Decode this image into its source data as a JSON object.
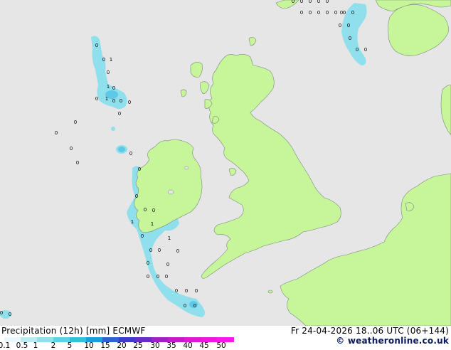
{
  "footer": {
    "title": "Precipitation (12h) [mm] ECMWF",
    "datetime": "Fr 24-04-2026 18..06 UTC (06+144)",
    "credit": "© weatheronline.co.uk"
  },
  "legend": {
    "ticks": [
      "0.1",
      "0.5",
      "1",
      "2",
      "5",
      "10",
      "15",
      "20",
      "25",
      "30",
      "35",
      "40",
      "45",
      "50"
    ],
    "colors": [
      "#e8f8fb",
      "#b8ecf2",
      "#8fe0ec",
      "#5ed2e6",
      "#32c0de",
      "#1aa0d6",
      "#2c64d0",
      "#3c3cc8",
      "#6a2cc4",
      "#9c22c2",
      "#c21cc4",
      "#dc1ad0",
      "#ec18dc",
      "#f818e8"
    ]
  },
  "map": {
    "sea_color": "#e6e6e6",
    "land_color": "#c6f59a",
    "coast_color": "#7a8a7a",
    "precip_light": "#8fe0ec",
    "precip_mid": "#5ec8e6",
    "markers": [
      {
        "label": "0"
      },
      {
        "label": "0"
      },
      {
        "label": "1"
      },
      {
        "label": "0"
      },
      {
        "label": "1"
      },
      {
        "label": "0"
      },
      {
        "label": "1"
      },
      {
        "label": "0"
      },
      {
        "label": "0"
      },
      {
        "label": "0"
      },
      {
        "label": "0"
      },
      {
        "label": "0"
      },
      {
        "label": "0"
      },
      {
        "label": "0"
      },
      {
        "label": "0"
      },
      {
        "label": "0"
      },
      {
        "label": "0"
      },
      {
        "label": "0"
      },
      {
        "label": "0"
      },
      {
        "label": "1"
      },
      {
        "label": "0"
      },
      {
        "label": "0"
      },
      {
        "label": "1"
      },
      {
        "label": "0"
      },
      {
        "label": "1"
      },
      {
        "label": "0"
      },
      {
        "label": "0"
      },
      {
        "label": "0"
      },
      {
        "label": "0"
      },
      {
        "label": "0"
      },
      {
        "label": "0"
      },
      {
        "label": "0"
      },
      {
        "label": "0"
      },
      {
        "label": "0"
      },
      {
        "label": "0"
      },
      {
        "label": "0"
      },
      {
        "label": "0"
      },
      {
        "label": "0"
      },
      {
        "label": "0"
      },
      {
        "label": "0"
      },
      {
        "label": "0"
      },
      {
        "label": "0"
      },
      {
        "label": "0"
      },
      {
        "label": "0"
      },
      {
        "label": "0"
      },
      {
        "label": "0"
      },
      {
        "label": "0"
      },
      {
        "label": "0"
      }
    ]
  }
}
